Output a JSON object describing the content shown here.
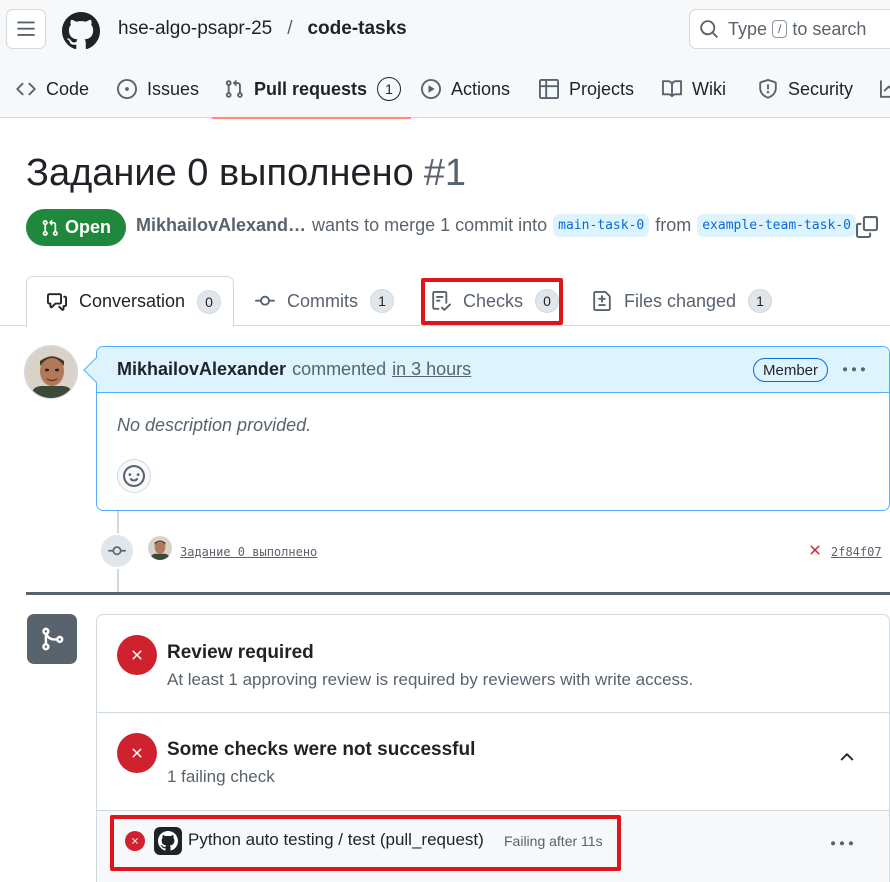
{
  "header": {
    "owner": "hse-algo-psapr-25",
    "separator": "/",
    "repo": "code-tasks",
    "search_prefix": "Type",
    "search_key": "/",
    "search_suffix": "to search"
  },
  "repo_nav": {
    "items": [
      {
        "label": "Code",
        "icon": "code-icon"
      },
      {
        "label": "Issues",
        "icon": "issue-opened-icon"
      },
      {
        "label": "Pull requests",
        "icon": "git-pull-request-icon",
        "count": "1",
        "selected": true
      },
      {
        "label": "Actions",
        "icon": "play-icon"
      },
      {
        "label": "Projects",
        "icon": "table-icon"
      },
      {
        "label": "Wiki",
        "icon": "book-icon"
      },
      {
        "label": "Security",
        "icon": "shield-icon"
      }
    ]
  },
  "pr": {
    "title": "Задание 0 выполнено",
    "number": "#1",
    "state": "Open",
    "author": "MikhailovAlexand…",
    "merge_text": "wants to merge 1 commit into",
    "base_branch": "main-task-0",
    "from_text": "from",
    "head_branch": "example-team-task-0"
  },
  "tabs": [
    {
      "label": "Conversation",
      "count": "0",
      "icon": "comment-discussion-icon",
      "active": true
    },
    {
      "label": "Commits",
      "count": "1",
      "icon": "git-commit-icon"
    },
    {
      "label": "Checks",
      "count": "0",
      "icon": "checklist-icon",
      "highlighted": true
    },
    {
      "label": "Files changed",
      "count": "1",
      "icon": "file-diff-icon"
    }
  ],
  "comment": {
    "author": "MikhailovAlexander",
    "action": "commented",
    "time": "in 3 hours",
    "badge": "Member",
    "body": "No description provided."
  },
  "commit": {
    "message": "Задание 0 выполнено",
    "sha": "2f84f07"
  },
  "mergebox": {
    "review_title": "Review required",
    "review_sub": "At least 1 approving review is required by reviewers with write access.",
    "checks_title": "Some checks were not successful",
    "checks_sub": "1 failing check",
    "check_name": "Python auto testing / test (pull_request)",
    "check_status": "Failing after 11s"
  },
  "colors": {
    "open_green": "#1f883d",
    "fail_red": "#cf222e",
    "highlight_red": "#e0141c",
    "link_blue": "#0969da",
    "nav_underline": "#fd8c73"
  }
}
